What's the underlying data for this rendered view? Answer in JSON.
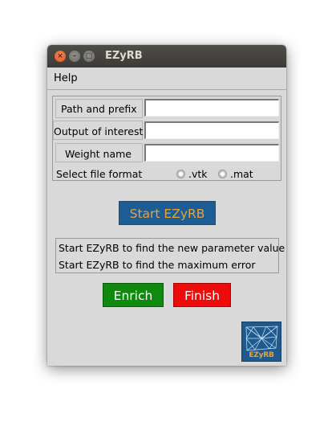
{
  "window": {
    "title": "EZyRB",
    "close_glyph": "×",
    "minimize_glyph": "–",
    "maximize_glyph": "□"
  },
  "menubar": {
    "items": [
      {
        "label": "Help"
      }
    ]
  },
  "form": {
    "path_label": "Path and prefix",
    "path_value": "",
    "output_label": "Output of interest",
    "output_value": "",
    "weight_label": "Weight name",
    "weight_value": "",
    "format_label": "Select file format",
    "format_options": [
      {
        "label": ".vtk",
        "selected": false
      },
      {
        "label": ".mat",
        "selected": false
      }
    ]
  },
  "actions": {
    "start_label": "Start EZyRB",
    "enrich_label": "Enrich",
    "finish_label": "Finish"
  },
  "status": {
    "lines": [
      "Start EZyRB to find the new parameter value",
      "Start EZyRB to find the maximum error"
    ]
  },
  "logo": {
    "text": "EZyRB",
    "icon": "ezyrb-logo"
  },
  "colors": {
    "start_bg": "#1d5d96",
    "start_fg": "#e8a33c",
    "enrich_bg": "#0f8a0f",
    "finish_bg": "#ee0b0b",
    "window_bg": "#d9d9d9"
  }
}
